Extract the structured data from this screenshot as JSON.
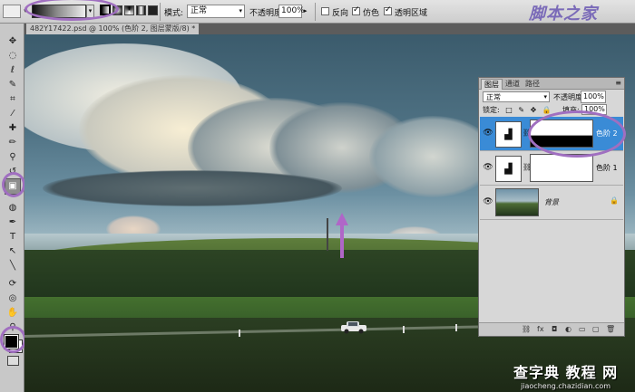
{
  "options_bar": {
    "mode_label": "模式:",
    "mode_value": "正常",
    "opacity_label": "不透明度:",
    "opacity_value": "100%",
    "reverse_label": "反向",
    "reverse_checked": false,
    "dither_label": "仿色",
    "dither_checked": true,
    "transparency_label": "透明区域",
    "transparency_checked": true
  },
  "watermark_top": "脚本之家",
  "document_tab": "482Y17422.psd @ 100% (色阶 2, 图层蒙版/8) *",
  "tools": [
    "move-tool-icon",
    "marquee-tool-icon",
    "lasso-tool-icon",
    "quick-select-tool-icon",
    "crop-tool-icon",
    "eyedropper-tool-icon",
    "healing-brush-icon",
    "brush-tool-icon",
    "clone-stamp-icon",
    "history-brush-icon",
    "eraser-icon",
    "gradient-tool-icon",
    "blur-tool-icon",
    "dodge-tool-icon",
    "pen-tool-icon",
    "type-tool-icon",
    "path-select-icon",
    "shape-tool-icon",
    "3d-rotate-icon",
    "3d-orbit-icon",
    "hand-tool-icon",
    "zoom-tool-icon"
  ],
  "colors": {
    "foreground": "#000000",
    "background": "#ffffff",
    "annotation": "#a06fc0",
    "selected_layer": "#3a8bd6"
  },
  "layers_panel": {
    "tabs": [
      "图层",
      "通道",
      "路径"
    ],
    "active_tab": "图层",
    "blend_mode": "正常",
    "opacity_label": "不透明度:",
    "opacity_value": "100%",
    "lock_label": "锁定:",
    "fill_label": "填充:",
    "fill_value": "100%",
    "layers": [
      {
        "name": "色阶 2",
        "type": "levels-adjustment",
        "selected": true,
        "visible": true
      },
      {
        "name": "色阶 1",
        "type": "levels-adjustment",
        "selected": false,
        "visible": true
      },
      {
        "name": "背景",
        "type": "image",
        "selected": false,
        "visible": true,
        "locked": true
      }
    ]
  },
  "watermark_bottom": {
    "main": "查字典 教程 网",
    "url": "jiaocheng.chazidian.com"
  }
}
